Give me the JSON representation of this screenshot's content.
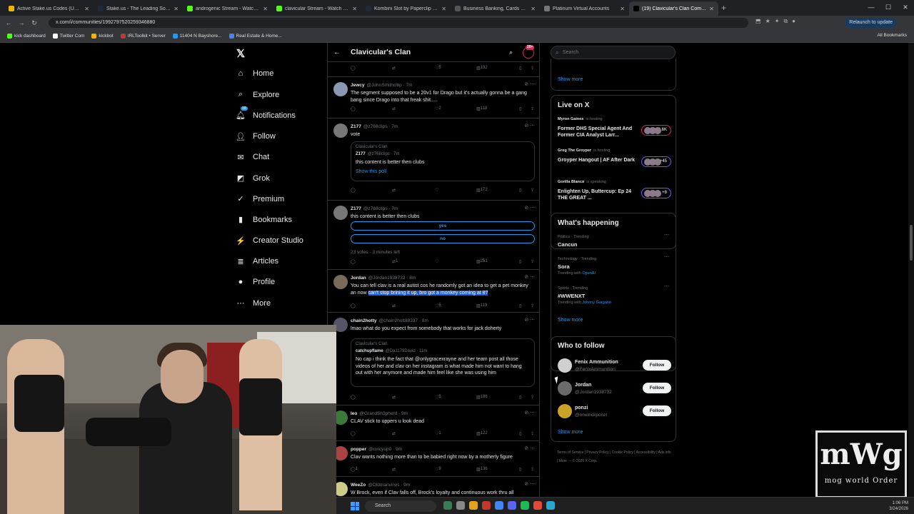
{
  "browser": {
    "tabs": [
      {
        "title": "Active Stake.us Codes (Update",
        "color": "#f1b40a"
      },
      {
        "title": "Stake.us - The Leading Social C",
        "color": "#1b2b3a"
      },
      {
        "title": "androgenic Stream - Watch Liv",
        "color": "#53fc18"
      },
      {
        "title": "clavicular Stream - Watch Live",
        "color": "#53fc18"
      },
      {
        "title": "Kombini Slot by Paperclip Gam",
        "color": "#1b2b3a"
      },
      {
        "title": "Business Banking, Cards & Tre",
        "color": "#555"
      },
      {
        "title": "Platinum Virtual Accounts",
        "color": "#777"
      },
      {
        "title": "(19) Clavicular's Clan Communi",
        "color": "#000"
      }
    ],
    "url": "x.com/i/communities/1992797520259346880",
    "relaunch": "Relaunch to update",
    "bookmarks": [
      "kick dashboard",
      "Twitter Com",
      "kickbot",
      "IRLToolkit • Server",
      "11404 N Bayshore...",
      "Real Estate & Home..."
    ],
    "all_bookmarks": "All Bookmarks"
  },
  "nav": {
    "items": [
      "Home",
      "Explore",
      "Notifications",
      "Follow",
      "Chat",
      "Grok",
      "Premium",
      "Bookmarks",
      "Creator Studio",
      "Articles",
      "Profile",
      "More"
    ],
    "notif_count": "19"
  },
  "header": {
    "title": "Clavicular's Clan",
    "badge": "20+"
  },
  "tweets": [
    {
      "acts": [
        "",
        "",
        "5",
        "132"
      ]
    },
    {
      "name": "Jewcy",
      "handle": "@JohnSmithclbp · 7m",
      "text": "The segment supposed to be a 20v1 for Drago but it's actually gonna be a gang bang since Drago into that freak shit.....",
      "acts": [
        "",
        "",
        "2",
        "118"
      ]
    },
    {
      "name": "Z177",
      "handle": "@z768clips · 7m",
      "text": "vote",
      "quote": {
        "community": "Clavicular's Clan",
        "name": "Z177",
        "handle": "@z768clips · 7m",
        "text": "this content is better then clubs",
        "link": "Show this poll"
      },
      "acts": [
        "",
        "",
        "",
        "172"
      ]
    },
    {
      "name": "Z177",
      "handle": "@z768clips · 7m",
      "text": "this content is better then clubs",
      "poll": [
        "yes",
        "no"
      ],
      "poll_meta": "23 votes · 3 minutes left",
      "acts": [
        "",
        "1",
        "",
        "251"
      ]
    },
    {
      "name": "Jordan",
      "handle": "@Jordan1938732 · 8m",
      "text_a": "You can tell clav is a real autist cos he randomly got an idea to get a pet monkey an now ",
      "text_b": "can't stop brining it up, bro got a monkey coming at 8?",
      "acts": [
        "",
        "",
        "5",
        "119"
      ]
    },
    {
      "name": "chain2hotty",
      "handle": "@chain2hott88337 · 8m",
      "text": "lmao what do you expect from somebody that works for jack doherty",
      "quote": {
        "community": "Clavicular's Clan",
        "name": "catchupflame",
        "handle": "@Da1179David · 11m",
        "text": "No cap i think the fact that @onlygracexrayne and her team post all those videos of her and clav on her instagram is what made him not want to hang out with her anymore and made him feel like she was using him"
      },
      "acts": [
        "",
        "",
        "5",
        "186"
      ]
    },
    {
      "name": "leo",
      "handle": "@GrandSh3pherd · 9m",
      "text": "CLAV stick to uppers u look dead",
      "acts": [
        "",
        "",
        "1",
        "122"
      ]
    },
    {
      "name": "popper",
      "handle": "@cincyup0 · 9m",
      "text": "Clav wants nothing more than to be babied right now by a motherly figure",
      "acts": [
        "1",
        "",
        "9",
        "136"
      ]
    },
    {
      "name": "WeeZo",
      "handle": "@Oldmanvinvs · 9m",
      "text": "W Brock, even if Clav falls off, Brock's loyalty and continuous work thru all",
      "acts": []
    }
  ],
  "right": {
    "search_placeholder": "Search",
    "show_more": "Show more",
    "live": {
      "title": "Live on X",
      "items": [
        {
          "host": "Myron Gaines",
          "role": "is hosting",
          "title": "Former DHS Special Agent And Former CIA Analyst Larr...",
          "count": "+3.6K",
          "color": "#e0245e"
        },
        {
          "host": "Greg The Groyper",
          "role": "is hosting",
          "title": "Groyper Hangout | AF After Dark",
          "count": "+45",
          "color": "#7856ff"
        },
        {
          "host": "Gorilla Blanco",
          "role": "is speaking",
          "title": "Enlighten Up, Buttercup: Ep 24 THE GREAT ...",
          "count": "+8",
          "color": "#7856ff"
        }
      ]
    },
    "happening": {
      "title": "What's happening",
      "items": [
        {
          "cat": "Politics · Trending",
          "name": "Cancun",
          "sub": ""
        },
        {
          "cat": "Technology · Trending",
          "name": "Sora",
          "sub_a": "Trending with ",
          "sub_b": "OpenAI"
        },
        {
          "cat": "Sports · Trending",
          "name": "#WWENXT",
          "sub_a": "Trending with ",
          "sub_b": "Johnny Gargano"
        }
      ]
    },
    "follow": {
      "title": "Who to follow",
      "button": "Follow",
      "items": [
        {
          "name": "Fenix Ammunition",
          "handle": "@FenixAmmunition",
          "color": "#d0d0d0"
        },
        {
          "name": "Jordan",
          "handle": "@Jordan1938732",
          "color": "#6a6a6a"
        },
        {
          "name": "ponzi",
          "handle": "@onetrickponzi",
          "color": "#c9a227"
        }
      ]
    },
    "footer": "Terms of Service  |  Privacy Policy  |  Cookie Policy  |  Accessibility  |  Ads info  |  More ···  © 2026 X Corp."
  },
  "overlay": {
    "logo_big": "mWg",
    "logo_small": "mog world Order"
  },
  "taskbar": {
    "search": "Search",
    "time": "1:06 PM",
    "date": "3/24/2026"
  }
}
